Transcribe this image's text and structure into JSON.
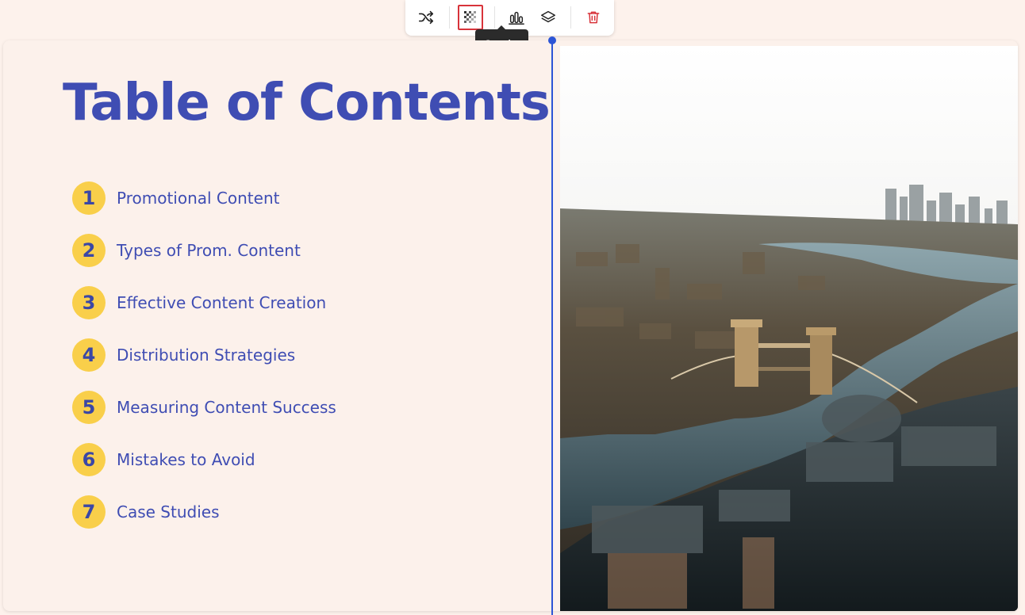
{
  "slide": {
    "title": "Table of Contents",
    "items": [
      {
        "number": "1",
        "label": "Promotional Content"
      },
      {
        "number": "2",
        "label": "Types of Prom. Content"
      },
      {
        "number": "3",
        "label": "Effective Content Creation"
      },
      {
        "number": "4",
        "label": "Distribution Strategies"
      },
      {
        "number": "5",
        "label": "Measuring Content Success"
      },
      {
        "number": "6",
        "label": "Mistakes to Avoid"
      },
      {
        "number": "7",
        "label": "Case Studies"
      }
    ]
  },
  "toolbar": {
    "buttons": [
      {
        "icon": "shuffle-icon"
      },
      {
        "icon": "opacity-icon",
        "active": true
      },
      {
        "icon": "align-bottom-icon"
      },
      {
        "icon": "layers-icon"
      },
      {
        "icon": "trash-icon"
      }
    ],
    "tooltip": "Opacity"
  },
  "colors": {
    "title": "#3f4db3",
    "badge": "#f9cf4a",
    "guide": "#2c55d6",
    "delete": "#d8333a"
  }
}
